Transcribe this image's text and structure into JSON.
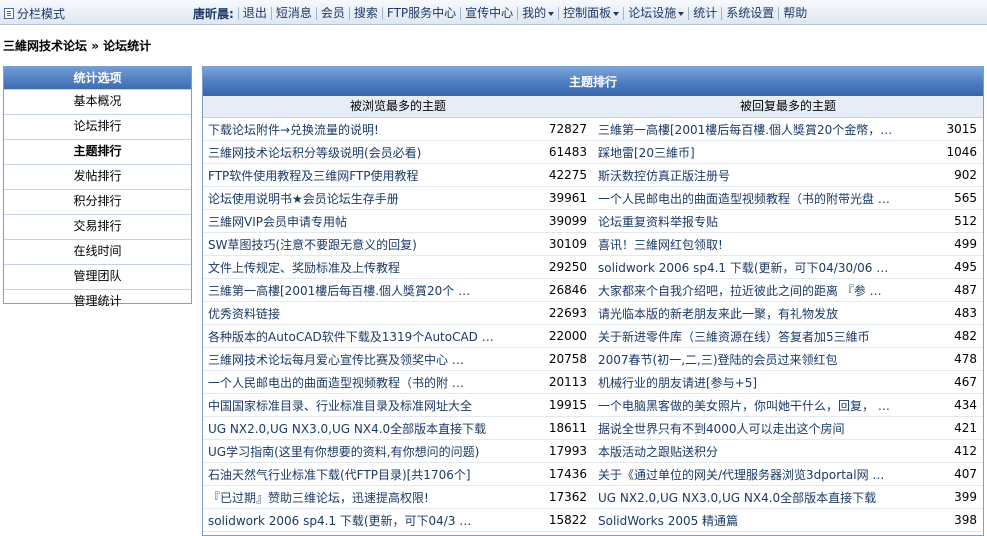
{
  "topbar": {
    "mode_label": "分栏模式",
    "username": "唐昕晨:",
    "items": [
      {
        "label": "退出",
        "dropdown": false
      },
      {
        "label": "短消息",
        "dropdown": false
      },
      {
        "label": "会员",
        "dropdown": false
      },
      {
        "label": "搜索",
        "dropdown": false
      },
      {
        "label": "FTP服务中心",
        "dropdown": false
      },
      {
        "label": "宣传中心",
        "dropdown": false
      },
      {
        "label": "我的",
        "dropdown": true
      },
      {
        "label": "控制面板",
        "dropdown": true
      },
      {
        "label": "论坛设施",
        "dropdown": true
      },
      {
        "label": "统计",
        "dropdown": false
      },
      {
        "label": "系统设置",
        "dropdown": false
      },
      {
        "label": "帮助",
        "dropdown": false
      }
    ]
  },
  "breadcrumb": {
    "forum": "三維网技术论坛",
    "sep": "»",
    "current": "论坛统计"
  },
  "sidebar": {
    "title": "统计选项",
    "active_index": 2,
    "items": [
      "基本概况",
      "论坛排行",
      "主题排行",
      "发帖排行",
      "积分排行",
      "交易排行",
      "在线时间",
      "管理团队",
      "管理统计"
    ]
  },
  "main": {
    "title": "主题排行",
    "left_header": "被浏览最多的主题",
    "right_header": "被回复最多的主题",
    "rows": [
      {
        "lt": "下载论坛附件→兑换流量的说明!",
        "ln": "72827",
        "rt": "三維第一高樓[2001樓后每百樓.個人獎賞20个金幣，…",
        "rn": "3015"
      },
      {
        "lt": "三維网技术论坛积分等级说明(会员必看)",
        "ln": "61483",
        "rt": "踩地雷[20三維币]",
        "rn": "1046"
      },
      {
        "lt": "FTP软件使用教程及三维网FTP使用教程",
        "ln": "42275",
        "rt": "斯沃数控仿真正版注册号",
        "rn": "902"
      },
      {
        "lt": "论坛使用说明书★会员论坛生存手册",
        "ln": "39961",
        "rt": "一个人民邮电出的曲面造型视频教程（书的附带光盘 …",
        "rn": "565"
      },
      {
        "lt": "三維网VIP会员申请专用帖",
        "ln": "39099",
        "rt": "论坛重复资料举报专贴",
        "rn": "512"
      },
      {
        "lt": "SW草图技巧(注意不要跟无意义的回复)",
        "ln": "30109",
        "rt": "喜讯！三維网红包领取!",
        "rn": "499"
      },
      {
        "lt": "文件上传规定、奖励标准及上传教程",
        "ln": "29250",
        "rt": "solidwork 2006 sp4.1 下载(更新，可下04/30/06 …",
        "rn": "495"
      },
      {
        "lt": "三維第一高樓[2001樓后每百樓.個人獎賞20个 …",
        "ln": "26846",
        "rt": "大家都来个自我介绍吧，拉近彼此之间的距离 『参 …",
        "rn": "487"
      },
      {
        "lt": "优秀资料链接",
        "ln": "22693",
        "rt": "请光临本版的新老朋友来此一聚，有礼物发放",
        "rn": "483"
      },
      {
        "lt": "各种版本的AutoCAD软件下载及1319个AutoCAD …",
        "ln": "22000",
        "rt": "关于新进零件库（三維资源在线）答复者加5三維币",
        "rn": "482"
      },
      {
        "lt": "三維网技术论坛每月爱心宣传比赛及领奖中心 …",
        "ln": "20758",
        "rt": "2007春节(初一,二,三)登陆的会员过来领红包",
        "rn": "478"
      },
      {
        "lt": "一个人民邮电出的曲面造型视频教程（书的附 …",
        "ln": "20113",
        "rt": "机械行业的朋友请进[参与+5]",
        "rn": "467"
      },
      {
        "lt": "中国国家标准目录、行业标准目录及标准网址大全",
        "ln": "19915",
        "rt": "一个电脑黑客做的美女照片，你叫她干什么，回复， …",
        "rn": "434"
      },
      {
        "lt": "UG NX2.0,UG NX3.0,UG NX4.0全部版本直接下载",
        "ln": "18611",
        "rt": "据说全世界只有不到4000人可以走出这个房间",
        "rn": "421"
      },
      {
        "lt": "UG学习指南(这里有你想要的资料,有你想问的问题)",
        "ln": "17993",
        "rt": "本版活动之跟贴送积分",
        "rn": "412"
      },
      {
        "lt": "石油天然气行业标准下载(代FTP目录)[共1706个]",
        "ln": "17436",
        "rt": "关于《通过单位的网关/代理服务器浏览3dportal网 …",
        "rn": "407"
      },
      {
        "lt": "『已过期』赞助三维论坛，迅速提高权限!",
        "ln": "17362",
        "rt": "UG NX2.0,UG NX3.0,UG NX4.0全部版本直接下载",
        "rn": "399"
      },
      {
        "lt": "solidwork 2006 sp4.1 下载(更新，可下04/3 …",
        "ln": "15822",
        "rt": "SolidWorks 2005 精通篇",
        "rn": "398"
      }
    ]
  }
}
